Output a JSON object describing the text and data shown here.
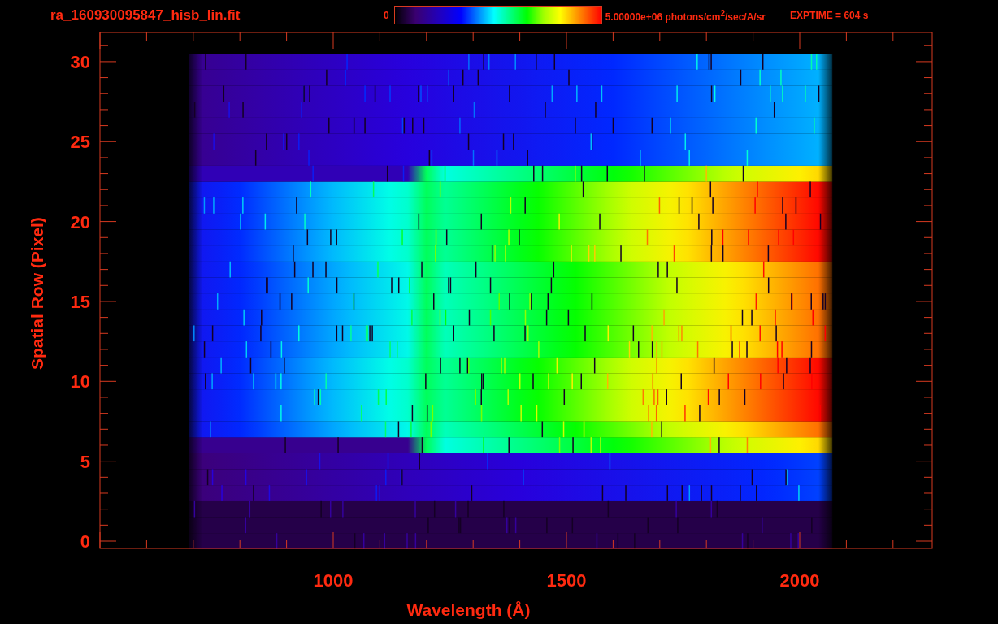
{
  "header": {
    "file_name": "ra_160930095847_hisb_lin.fit",
    "scale_min": "0",
    "scale_max": "5.00000e+06 photons/cm$^{2}$/sec/A/sr",
    "exposure": "EXPTIME = 604 s"
  },
  "plot": {
    "y_axis": {
      "label": "Spatial Row (Pixel)",
      "ticks": [
        "30",
        "25",
        "20",
        "15",
        "10",
        "5",
        "0"
      ]
    },
    "x_axis": {
      "label": "Wavelength (Å)",
      "ticks": [
        "1000",
        "1500",
        "2000"
      ]
    }
  }
}
